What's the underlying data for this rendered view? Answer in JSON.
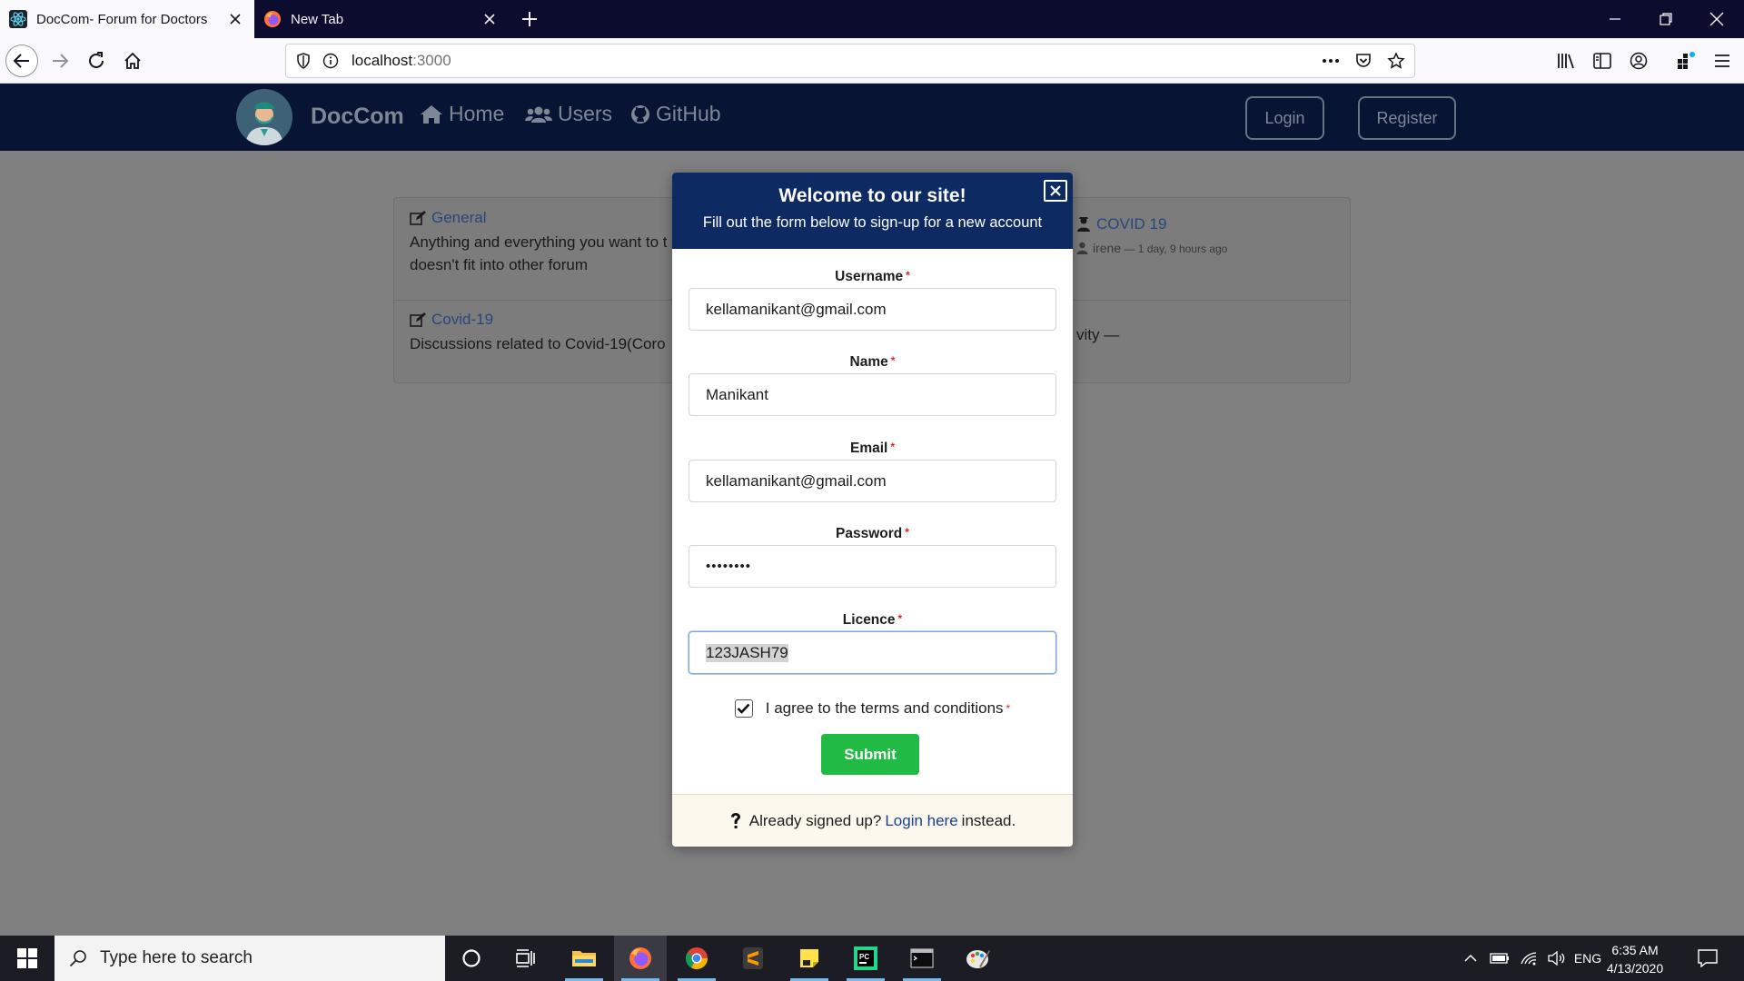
{
  "browser": {
    "tabs": [
      {
        "title": "DocCom- Forum for Doctors",
        "active": true
      },
      {
        "title": "New Tab",
        "active": false
      }
    ],
    "url_host": "localhost",
    "url_port": ":3000"
  },
  "site": {
    "brand": "DocCom",
    "nav": [
      {
        "label": "Home",
        "icon": "home-icon"
      },
      {
        "label": "Users",
        "icon": "users-icon"
      },
      {
        "label": "GitHub",
        "icon": "github-icon"
      }
    ],
    "login_label": "Login",
    "register_label": "Register"
  },
  "forums": [
    {
      "title": "General",
      "description_lines": [
        "Anything and everything you want to t",
        "doesn't fit into other forum"
      ]
    },
    {
      "title": "Covid-19",
      "description_lines": [
        "Discussions related to Covid-19(Coro"
      ]
    }
  ],
  "latest": {
    "thread_title": "COVID 19",
    "author": "irene",
    "time": " — 1 day, 9 hours ago",
    "activity_text": "vity —"
  },
  "modal": {
    "title": "Welcome to our site!",
    "subtitle": "Fill out the form below to sign-up for a new account",
    "fields": [
      {
        "label": "Username",
        "value": "kellamanikant@gmail.com"
      },
      {
        "label": "Name",
        "value": "Manikant"
      },
      {
        "label": "Email",
        "value": "kellamanikant@gmail.com"
      },
      {
        "label": "Password",
        "value": "••••••••"
      },
      {
        "label": "Licence",
        "value": "123JASH79"
      }
    ],
    "required_mark": "*",
    "agree_label": "I agree to the terms and conditions",
    "agree_checked": true,
    "submit_label": "Submit",
    "footer_prefix": "Already signed up?",
    "footer_link": "Login here",
    "footer_suffix": "instead."
  },
  "taskbar": {
    "search_placeholder": "Type here to search",
    "lang": "ENG",
    "time": "6:35 AM",
    "date": "4/13/2020"
  },
  "colors": {
    "site_nav": "#071433",
    "modal_header": "#0d2a63",
    "submit": "#21ba45",
    "link": "#26487a"
  }
}
